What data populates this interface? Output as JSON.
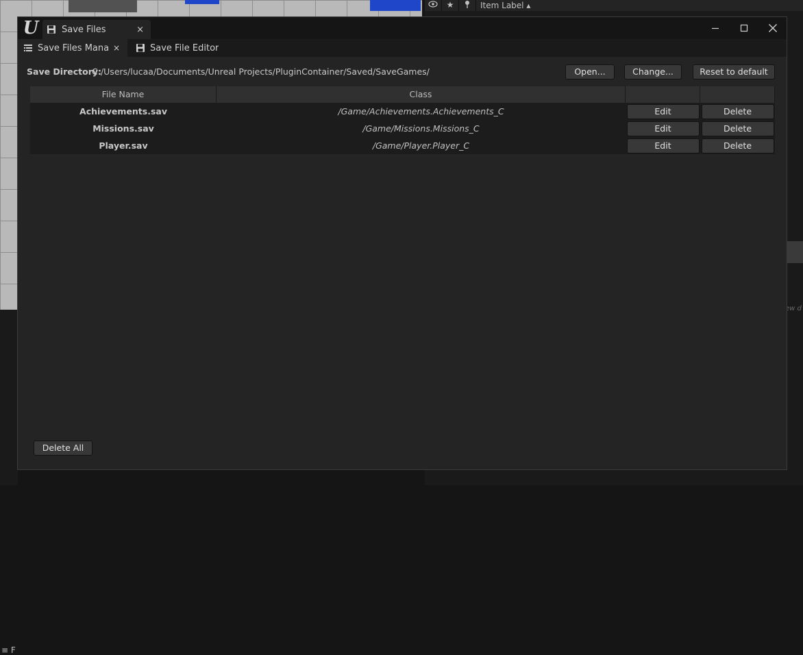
{
  "background": {
    "outliner_header_label": "Item Label",
    "outliner_ghost_text": "ew d",
    "left_panel_label": "F"
  },
  "window": {
    "title_tab_label": "Save Files",
    "title_tab_close": "×",
    "controls": {
      "minimize": "minimize-icon",
      "maximize": "maximize-icon",
      "close": "close-icon"
    }
  },
  "subtabs": [
    {
      "label": "Save Files Mana...",
      "close": "×"
    },
    {
      "label": "Save File Editor"
    }
  ],
  "directory": {
    "label": "Save Directory:",
    "path": "C:/Users/lucaa/Documents/Unreal Projects/PluginContainer/Saved/SaveGames/",
    "open_label": "Open...",
    "change_label": "Change...",
    "reset_label": "Reset to default"
  },
  "table": {
    "headers": [
      "File Name",
      "Class",
      "",
      ""
    ],
    "rows": [
      {
        "file": "Achievements.sav",
        "class": "/Game/Achievements.Achievements_C",
        "edit": "Edit",
        "delete": "Delete"
      },
      {
        "file": "Missions.sav",
        "class": "/Game/Missions.Missions_C",
        "edit": "Edit",
        "delete": "Delete"
      },
      {
        "file": "Player.sav",
        "class": "/Game/Player.Player_C",
        "edit": "Edit",
        "delete": "Delete"
      }
    ]
  },
  "footer": {
    "delete_all_label": "Delete All"
  },
  "colors": {
    "window_bg": "#242424",
    "titlebar_bg": "#151515",
    "button_bg": "#383838"
  }
}
